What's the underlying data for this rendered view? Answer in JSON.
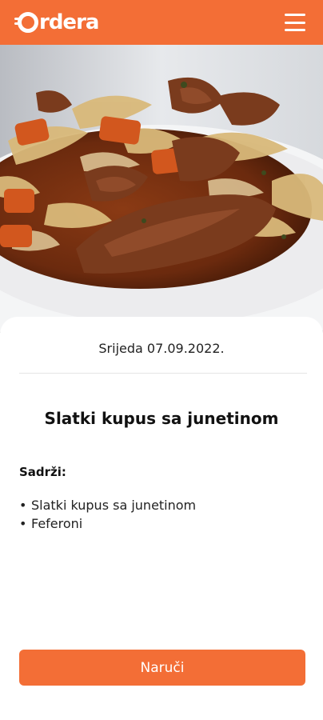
{
  "header": {
    "logo_text": "rdera",
    "menu_icon": "hamburger-menu-icon",
    "background_color": "#f36e36"
  },
  "hero": {
    "image": "food-photo"
  },
  "meal": {
    "date": "Srijeda 07.09.2022.",
    "title": "Slatki kupus sa junetinom",
    "contains_label": "Sadrži:",
    "items": [
      "Slatki kupus sa junetinom",
      "Feferoni"
    ]
  },
  "actions": {
    "order_label": "Naruči",
    "accent_color": "#f36e36"
  }
}
